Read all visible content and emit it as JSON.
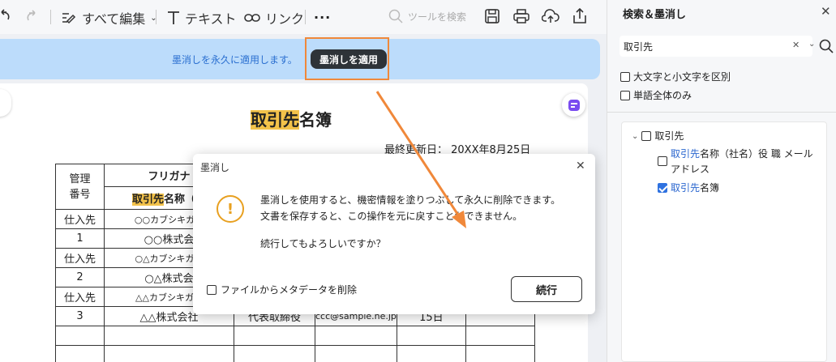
{
  "toolbar": {
    "edit_all": "すべて編集",
    "text": "テキスト",
    "link": "リンク",
    "search_placeholder": "ツールを検索"
  },
  "banner": {
    "message": "墨消しを永久に適用します。",
    "apply_button": "墨消しを適用"
  },
  "document": {
    "title_highlight": "取引先",
    "title_rest": "名簿",
    "updated": "最終更新日：  20XX年8月25日",
    "table": {
      "h_mgmt": "管理番号",
      "h_furigana": "フリガナ",
      "h_name_hl": "取引先",
      "h_name_rest": "名称（社",
      "rows": [
        {
          "type": "仕入先",
          "num": "1",
          "kana": "○○カブシキガイ",
          "name": "○○株式会",
          "title": "",
          "email": "",
          "date": ""
        },
        {
          "type": "仕入先",
          "num": "2",
          "kana": "○△カブシキガイ",
          "name": "○△株式会",
          "title": "",
          "email": "",
          "date": ""
        },
        {
          "type": "仕入先",
          "num": "3",
          "kana": "△△カブシキガイ",
          "name": "△△株式会社",
          "title": "代表取締役",
          "email": "ccc@sample.ne.jp",
          "date": "15日"
        }
      ]
    }
  },
  "dialog": {
    "title": "墨消し",
    "line1": "墨消しを使用すると、機密情報を塗りつぶして永久に削除できます。",
    "line2": "文書を保存すると、この操作を元に戻すことができません。",
    "line3": "続行してもよろしいですか？",
    "checkbox_label": "ファイルからメタデータを削除",
    "continue_button": "続行"
  },
  "panel": {
    "title": "検索＆墨消し",
    "search_value": "取引先",
    "opt_case": "大文字と小文字を区別",
    "opt_whole": "単語全体のみ",
    "results": {
      "group": "取引先",
      "r1_hl": "取引先",
      "r1_rest": "名称（社名）役 職 メール",
      "r1_line2": "アドレス",
      "r2_hl": "取引先",
      "r2_rest": "名簿"
    }
  },
  "colors": {
    "accent_blue": "#2f72e0",
    "highlight": "#f3c24a",
    "orange": "#f0883a"
  }
}
